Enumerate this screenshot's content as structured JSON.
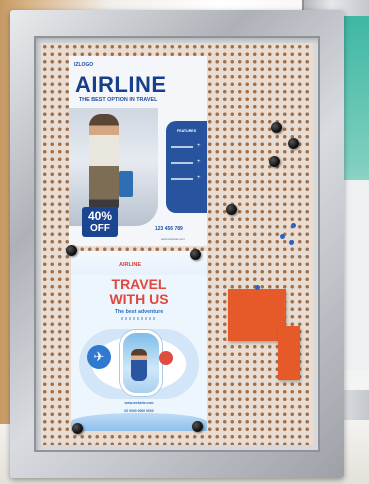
{
  "poster_airline": {
    "logo": "IZLOGO",
    "title": "AIRLINE",
    "tagline": "THE BEST OPTION IN TRAVEL",
    "features_label": "FEATURES",
    "discount": "40%",
    "discount_word": "OFF",
    "phone": "123 456 789",
    "website": "www.website.com"
  },
  "poster_travel": {
    "brand": "AIRLINE",
    "title_line1": "TRAVEL",
    "title_line2": "WITH US",
    "subtitle": "The best adventure",
    "website": "www.website.com",
    "phone": "00 0000 0000 0000"
  },
  "colors": {
    "frame": "#b9bdc3",
    "pegboard": "#e9ddd3",
    "poster_blue": "#183f8a",
    "travel_red": "#e2463c",
    "sticky_note": "#e55a28"
  }
}
